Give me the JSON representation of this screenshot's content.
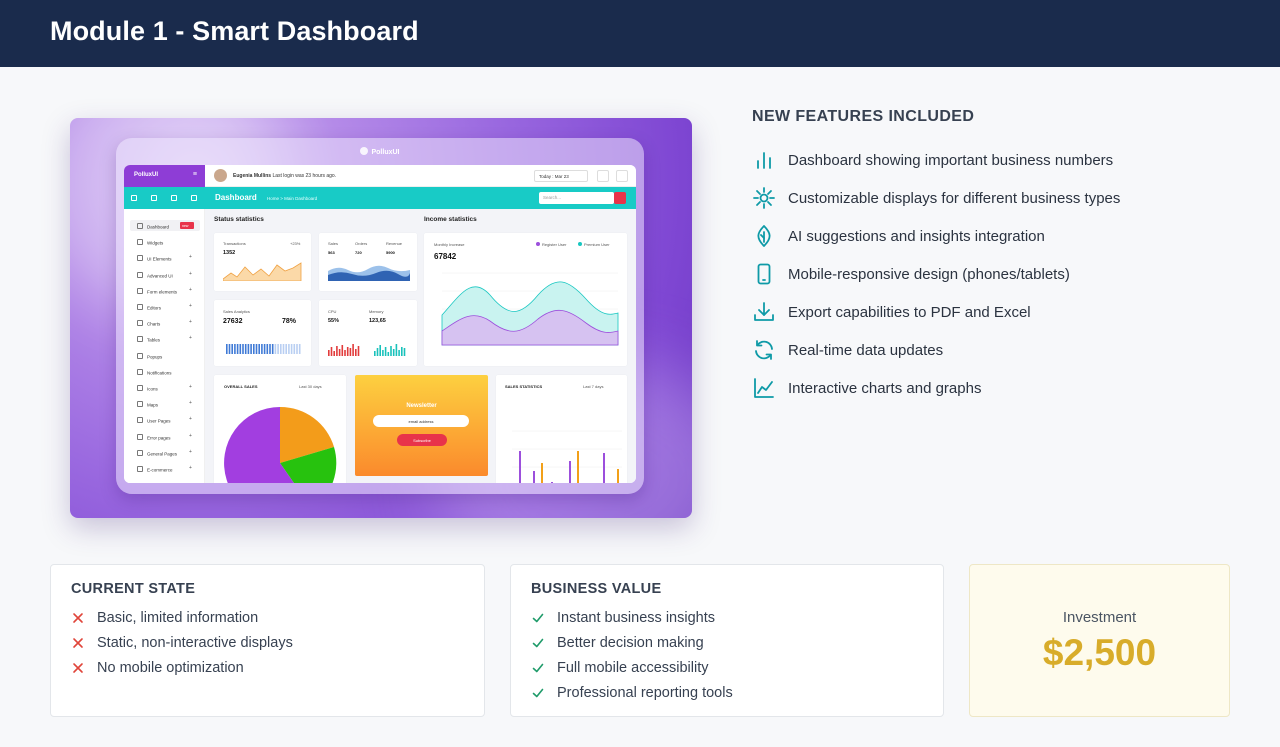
{
  "header": {
    "title": "Module 1 - Smart Dashboard"
  },
  "preview": {
    "brand": "PolluxUI",
    "app_brand": "PolluxUI",
    "user": "Eugenia Mullins",
    "user_sub": "Last login was 23 hours ago.",
    "date": "Today : Mar 23",
    "nav_title": "Dashboard",
    "breadcrumb": "Home > Main Dashboard",
    "search_placeholder": "Search...",
    "sidebar": [
      {
        "label": "Dashboard",
        "badge": "new"
      },
      {
        "label": "Widgets"
      },
      {
        "label": "UI Elements",
        "plus": true
      },
      {
        "label": "Advanced UI",
        "plus": true
      },
      {
        "label": "Form elements",
        "plus": true
      },
      {
        "label": "Editors",
        "plus": true
      },
      {
        "label": "Charts",
        "plus": true
      },
      {
        "label": "Tables",
        "plus": true
      },
      {
        "label": "Popups"
      },
      {
        "label": "Notifications"
      },
      {
        "label": "Icons",
        "plus": true
      },
      {
        "label": "Maps",
        "plus": true
      },
      {
        "label": "User Pages",
        "plus": true
      },
      {
        "label": "Error pages",
        "plus": true
      },
      {
        "label": "General Pages",
        "plus": true
      },
      {
        "label": "E-commerce",
        "plus": true
      }
    ],
    "status_title": "Status statistics",
    "income_title": "Income statistics",
    "transactions": {
      "label": "Transactions",
      "pct": "+23%",
      "value": "1352"
    },
    "sales": {
      "l1": "Sales",
      "l2": "Orders",
      "l3": "Revenue",
      "v1": "563",
      "v2": "720",
      "v3": "5900"
    },
    "analytics": {
      "label": "Sales Analytics",
      "value": "27632",
      "pct": "78%"
    },
    "cpu": {
      "l1": "CPU",
      "l2": "Memory",
      "v1": "55%",
      "v2": "123,65"
    },
    "income": {
      "label": "Monthly Increase",
      "value": "67842",
      "legend1": "Register User",
      "legend2": "Premium User"
    },
    "overall": {
      "title": "OVERALL SALES",
      "filter": "Last 30 days"
    },
    "newsletter": {
      "title": "Newsletter",
      "email": "email address",
      "button": "Subscribe"
    },
    "sales_stats": {
      "title": "SALES STATISTICS",
      "filter": "Last 7 days"
    }
  },
  "features": {
    "title": "NEW FEATURES INCLUDED",
    "items": [
      {
        "icon": "bar-chart-icon",
        "label": "Dashboard showing important business numbers"
      },
      {
        "icon": "sun-gear-icon",
        "label": "Customizable displays for different business types"
      },
      {
        "icon": "ai-leaf-icon",
        "label": "AI suggestions and insights integration"
      },
      {
        "icon": "mobile-phone-icon",
        "label": "Mobile-responsive design (phones/tablets)"
      },
      {
        "icon": "download-icon",
        "label": "Export capabilities to PDF and Excel"
      },
      {
        "icon": "refresh-icon",
        "label": "Real-time data updates"
      },
      {
        "icon": "line-chart-icon",
        "label": "Interactive charts and graphs"
      }
    ]
  },
  "current_state": {
    "title": "CURRENT STATE",
    "items": [
      "Basic, limited information",
      "Static, non-interactive displays",
      "No mobile optimization"
    ]
  },
  "business_value": {
    "title": "BUSINESS VALUE",
    "items": [
      "Instant business insights",
      "Better decision making",
      "Full mobile accessibility",
      "Professional reporting tools"
    ]
  },
  "investment": {
    "label": "Investment",
    "value": "$2,500"
  },
  "colors": {
    "header": "#1a2b4c",
    "accent": "#0e9aa7",
    "cross": "#e0453a",
    "check": "#1f9b6a",
    "gold": "#d8ac2a"
  }
}
